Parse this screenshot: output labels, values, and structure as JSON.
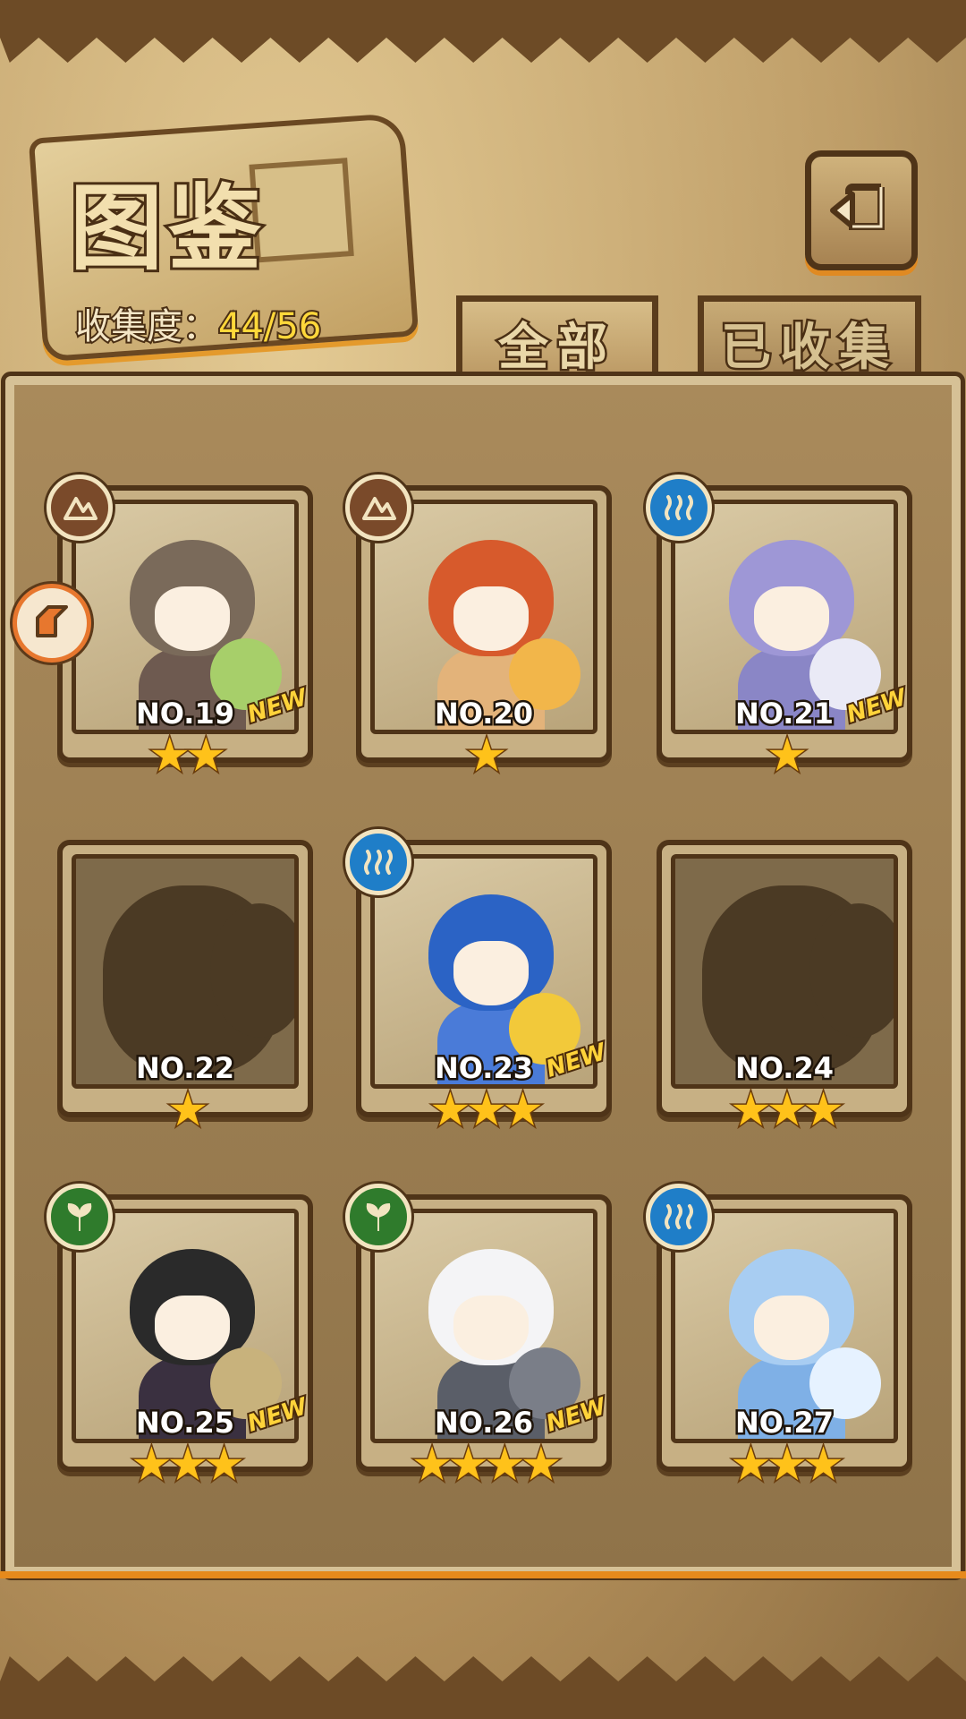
{
  "header": {
    "title": "图鉴",
    "collection_label": "收集度：",
    "collection_count": "44/56"
  },
  "tabs": {
    "all": "全部",
    "collected": "已收集"
  },
  "cards": [
    {
      "number": "NO.19",
      "stars": "★★",
      "new": "NEW",
      "element": "earth",
      "unlocked": true,
      "palette": [
        "#7a6a5a",
        "#a7cf6a",
        "#6e5a50"
      ]
    },
    {
      "number": "NO.20",
      "stars": "★",
      "new": "",
      "element": "earth",
      "unlocked": true,
      "palette": [
        "#d75a2c",
        "#f2b64a",
        "#e3b37a"
      ]
    },
    {
      "number": "NO.21",
      "stars": "★",
      "new": "NEW",
      "element": "water",
      "unlocked": true,
      "palette": [
        "#9e97d6",
        "#eaeaf6",
        "#8a86c6"
      ]
    },
    {
      "number": "NO.22",
      "stars": "★",
      "new": "",
      "element": "",
      "unlocked": false
    },
    {
      "number": "NO.23",
      "stars": "★★★",
      "new": "NEW",
      "element": "water",
      "unlocked": true,
      "palette": [
        "#2b63c5",
        "#f2c93a",
        "#4a7bd8"
      ]
    },
    {
      "number": "NO.24",
      "stars": "★★★",
      "new": "",
      "element": "",
      "unlocked": false
    },
    {
      "number": "NO.25",
      "stars": "★★★",
      "new": "NEW",
      "element": "nature",
      "unlocked": true,
      "palette": [
        "#2a2a2a",
        "#c8b27c",
        "#3a3040"
      ]
    },
    {
      "number": "NO.26",
      "stars": "★★★★",
      "new": "NEW",
      "element": "nature",
      "unlocked": true,
      "palette": [
        "#f4f4f6",
        "#7a7e88",
        "#5a5e68"
      ]
    },
    {
      "number": "NO.27",
      "stars": "★★★",
      "new": "",
      "element": "water",
      "unlocked": true,
      "palette": [
        "#a8cdf2",
        "#e6f2ff",
        "#7fb0e6"
      ]
    }
  ],
  "colors": {
    "earth": "#7a4a2a",
    "water": "#1f7ec8",
    "nature": "#2f7b2c",
    "star": "#ffc21a",
    "new": "#ffd33a",
    "count": "#ffd83a"
  }
}
